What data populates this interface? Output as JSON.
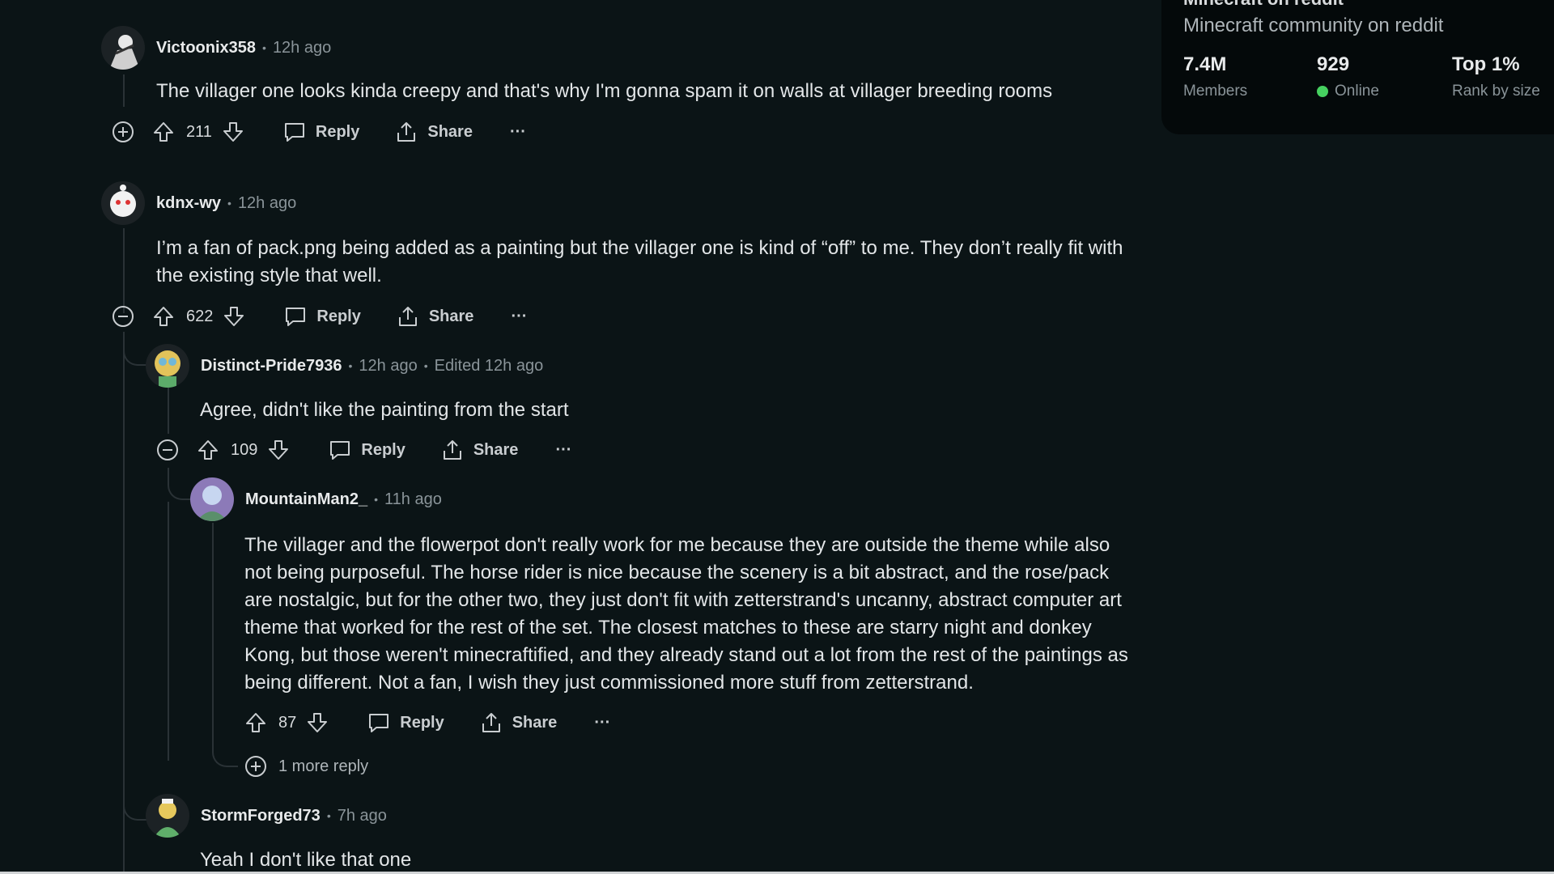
{
  "sidebar": {
    "title": "Minecraft on reddit",
    "subtitle": "Minecraft community on reddit",
    "stats": [
      {
        "value": "7.4M",
        "label": "Members"
      },
      {
        "value": "929",
        "label": "Online"
      },
      {
        "value": "Top 1%",
        "label": "Rank by size"
      }
    ]
  },
  "actions": {
    "reply": "Reply",
    "share": "Share",
    "more": "···"
  },
  "comments": {
    "c1": {
      "user": "Victoonix358",
      "time": "12h ago",
      "body": "The villager one looks kinda creepy and that's why I'm gonna spam it on walls at villager breeding rooms",
      "votes": "211"
    },
    "c2": {
      "user": "kdnx-wy",
      "time": "12h ago",
      "body": "I’m a fan of pack.png being added as a painting but the villager one is kind of “off” to me. They don’t really fit with the existing style that well.",
      "votes": "622"
    },
    "c3": {
      "user": "Distinct-Pride7936",
      "time": "12h ago",
      "edited": "Edited 12h ago",
      "body": "Agree, didn't like the painting from the start",
      "votes": "109"
    },
    "c4": {
      "user": "MountainMan2_",
      "time": "11h ago",
      "body": "The villager and the flowerpot don't really work for me because they are outside the theme while also not being purposeful. The horse rider is nice because the scenery is a bit abstract, and the rose/pack are nostalgic, but for the other two, they just don't fit with zetterstrand's uncanny, abstract computer art theme that worked for the rest of the set. The closest matches to these are starry night and donkey Kong, but those weren't minecraftified, and they already stand out a lot from the rest of the paintings as being different. Not a fan, I wish they just commissioned more stuff from zetterstrand.",
      "votes": "87"
    },
    "c5": {
      "user": "StormForged73",
      "time": "7h ago",
      "body": "Yeah I don't like that one"
    }
  },
  "more_replies": "1 more reply"
}
